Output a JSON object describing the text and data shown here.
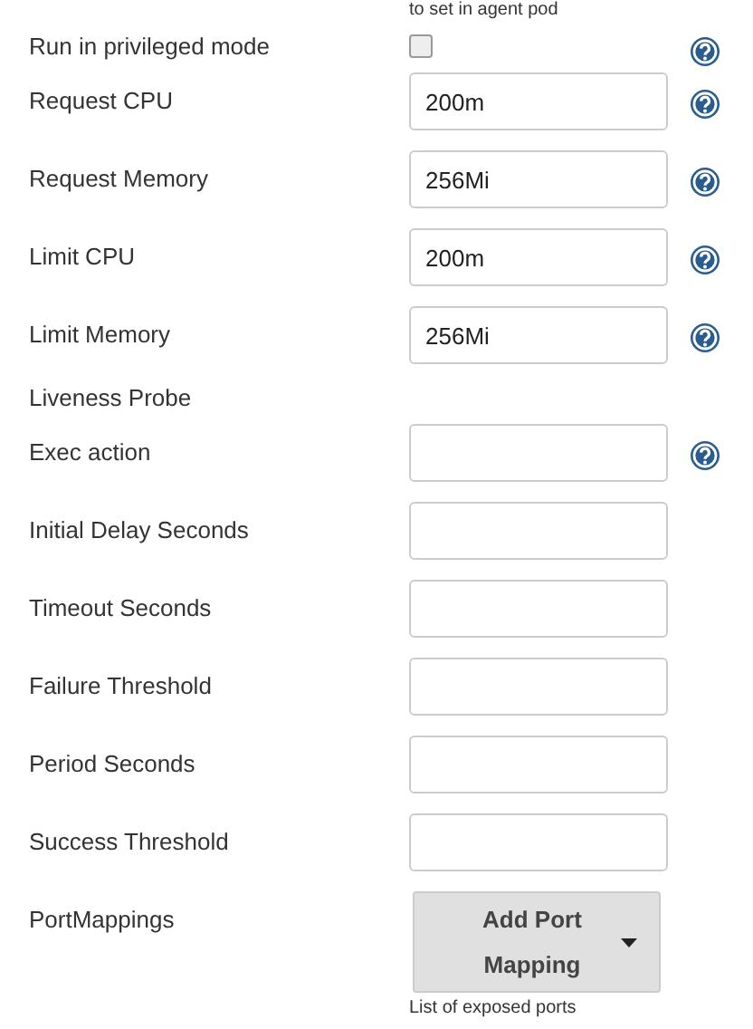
{
  "top_note": "to set in agent pod",
  "rows": [
    {
      "kind": "checkbox",
      "label": "Run in privileged mode",
      "checked": false,
      "help": true
    },
    {
      "kind": "text",
      "label": "Request CPU",
      "value": "200m",
      "help": true
    },
    {
      "kind": "text",
      "label": "Request Memory",
      "value": "256Mi",
      "help": true
    },
    {
      "kind": "text",
      "label": "Limit CPU",
      "value": "200m",
      "help": true
    },
    {
      "kind": "text",
      "label": "Limit Memory",
      "value": "256Mi",
      "help": true
    },
    {
      "kind": "heading",
      "label": "Liveness Probe"
    },
    {
      "kind": "text",
      "label": "Exec action",
      "help": true
    },
    {
      "kind": "text",
      "label": "Initial Delay Seconds",
      "help": false
    },
    {
      "kind": "text",
      "label": "Timeout Seconds",
      "help": false
    },
    {
      "kind": "text",
      "label": "Failure Threshold",
      "help": false
    },
    {
      "kind": "text",
      "label": "Period Seconds",
      "help": false
    },
    {
      "kind": "text",
      "label": "Success Threshold",
      "help": false
    },
    {
      "kind": "button",
      "label": "PortMappings",
      "button": "Add Port Mapping",
      "note": "List of exposed ports"
    }
  ]
}
